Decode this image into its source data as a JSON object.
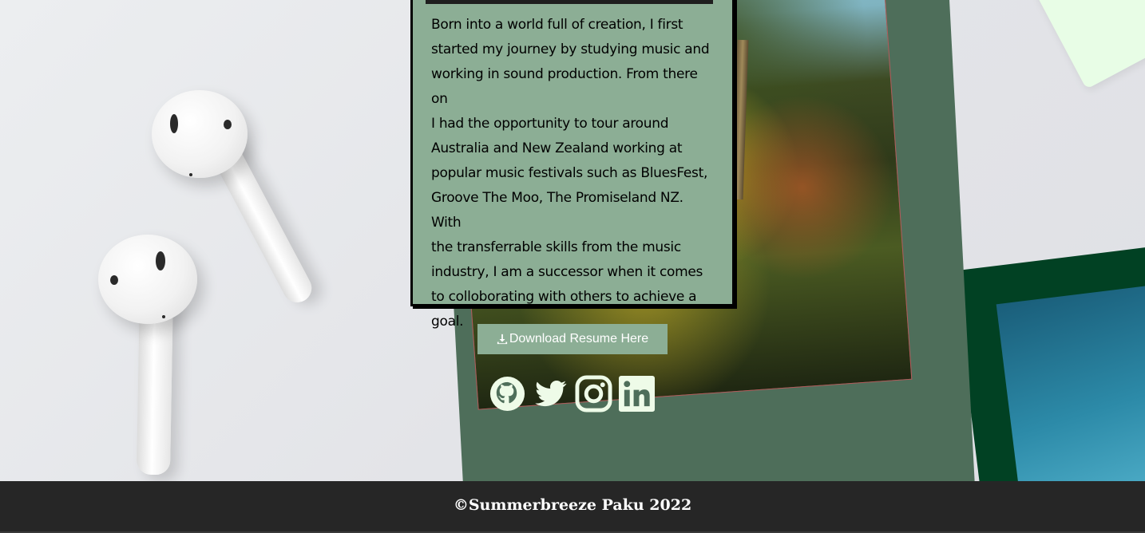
{
  "bio": {
    "lines": [
      "Born into a world full of creation, I first",
      "started my journey by studying music and",
      "working in sound production. From there on",
      "I had the opportunity to tour around",
      "Australia and New Zealand working at",
      "popular music festivals such as BluesFest,",
      "Groove The Moo, The Promiseland NZ. With",
      "the transferrable skills from the music",
      "industry, I am a successor when it comes",
      "to colloborating with others to achieve a",
      "goal."
    ]
  },
  "download": {
    "label": "Download Resume Here",
    "icon": "download-icon"
  },
  "socials": [
    {
      "name": "github-icon"
    },
    {
      "name": "twitter-icon"
    },
    {
      "name": "instagram-icon"
    },
    {
      "name": "linkedin-icon"
    }
  ],
  "footer": {
    "copyright": "©Summerbreeze Paku 2022"
  },
  "colors": {
    "card_green": "#4e6e5a",
    "box_green": "#8cae95",
    "dark_polaroid": "#014123",
    "footer_bg": "#262626",
    "icon_color": "#eefbe8"
  }
}
